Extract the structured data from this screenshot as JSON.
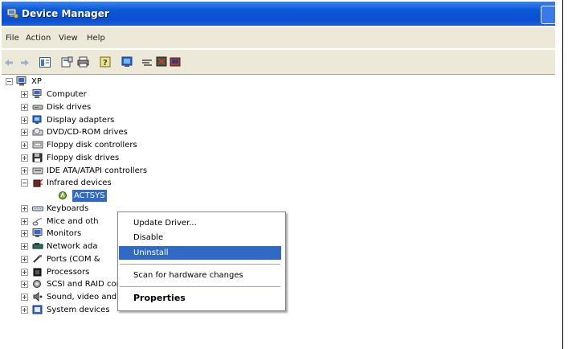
{
  "window": {
    "title": "Device Manager"
  },
  "menu": {
    "file": "File",
    "action": "Action",
    "view": "View",
    "help": "Help"
  },
  "toolbar_icons": [
    "back-icon",
    "forward-icon",
    "show-hide-tree-icon",
    "properties-icon",
    "print-icon",
    "help-icon",
    "update-driver-icon",
    "scan-hardware-icon",
    "disable-icon",
    "uninstall-icon"
  ],
  "tree": {
    "root": "XP",
    "items": [
      {
        "label": "Computer",
        "icon": "computer-icon",
        "expanded": false
      },
      {
        "label": "Disk drives",
        "icon": "disk-drive-icon",
        "expanded": false
      },
      {
        "label": "Display adapters",
        "icon": "display-adapter-icon",
        "expanded": false
      },
      {
        "label": "DVD/CD-ROM drives",
        "icon": "cdrom-icon",
        "expanded": false
      },
      {
        "label": "Floppy disk controllers",
        "icon": "floppy-controller-icon",
        "expanded": false
      },
      {
        "label": "Floppy disk drives",
        "icon": "floppy-drive-icon",
        "expanded": false
      },
      {
        "label": "IDE ATA/ATAPI controllers",
        "icon": "ide-controller-icon",
        "expanded": false
      },
      {
        "label": "Infrared devices",
        "icon": "infrared-icon",
        "expanded": true
      },
      {
        "label": "ACTSYS",
        "icon": "infrared-device-icon",
        "child": true,
        "selected": true
      },
      {
        "label": "Keyboards",
        "icon": "keyboard-icon",
        "expanded": false
      },
      {
        "label": "Mice and oth",
        "icon": "mouse-icon",
        "expanded": false
      },
      {
        "label": "Monitors",
        "icon": "monitor-icon",
        "expanded": false
      },
      {
        "label": "Network ada",
        "icon": "network-icon",
        "expanded": false
      },
      {
        "label": "Ports (COM &",
        "icon": "port-icon",
        "expanded": false
      },
      {
        "label": "Processors",
        "icon": "processor-icon",
        "expanded": false
      },
      {
        "label": "SCSI and RAID controllers",
        "icon": "scsi-icon",
        "expanded": false
      },
      {
        "label": "Sound, video and game controllers",
        "icon": "sound-icon",
        "expanded": false
      },
      {
        "label": "System devices",
        "icon": "system-icon",
        "expanded": false
      }
    ]
  },
  "context_menu": {
    "update_driver": "Update Driver...",
    "disable": "Disable",
    "uninstall": "Uninstall",
    "scan": "Scan for hardware changes",
    "properties": "Properties"
  },
  "colors": {
    "title_blue": "#0a4fd0",
    "selection": "#316ac5",
    "chrome": "#ece9d8"
  }
}
